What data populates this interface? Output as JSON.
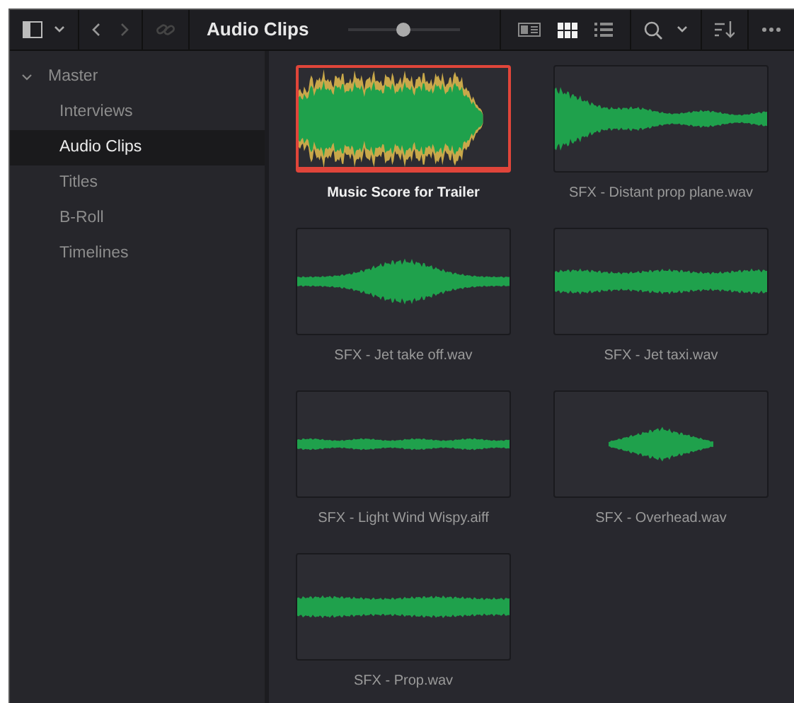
{
  "toolbar": {
    "title": "Audio Clips",
    "zoom": {
      "level": 0.5
    },
    "view_modes": [
      {
        "kind": "metadata",
        "selected": false
      },
      {
        "kind": "thumbnail",
        "selected": true
      },
      {
        "kind": "list",
        "selected": false
      }
    ]
  },
  "sidebar": {
    "items": [
      {
        "label": "Master",
        "expanded": true,
        "selected": false,
        "children": [
          {
            "label": "Interviews",
            "selected": false
          },
          {
            "label": "Audio Clips",
            "selected": true
          },
          {
            "label": "Titles",
            "selected": false
          },
          {
            "label": "B-Roll",
            "selected": false
          },
          {
            "label": "Timelines",
            "selected": false
          }
        ]
      }
    ]
  },
  "clips": [
    {
      "name": "Music Score for Trailer",
      "selected": true
    },
    {
      "name": "SFX - Distant prop plane.wav",
      "selected": false
    },
    {
      "name": "SFX - Jet take off.wav",
      "selected": false
    },
    {
      "name": "SFX - Jet taxi.wav",
      "selected": false
    },
    {
      "name": "SFX - Light Wind Wispy.aiff",
      "selected": false
    },
    {
      "name": "SFX - Overhead.wav",
      "selected": false
    },
    {
      "name": "SFX - Prop.wav",
      "selected": false
    }
  ]
}
